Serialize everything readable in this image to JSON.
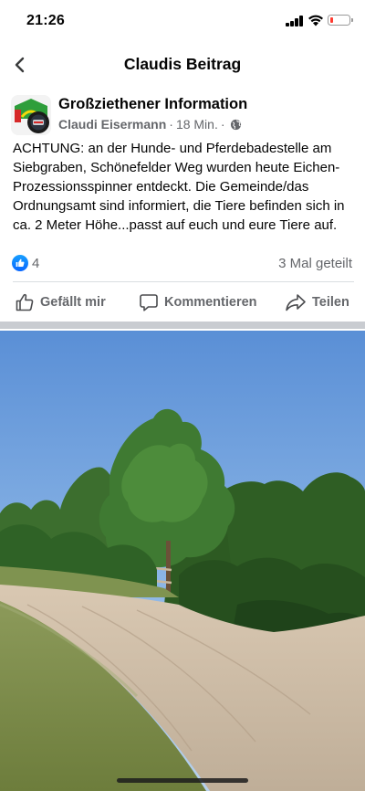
{
  "status_bar": {
    "time": "21:26",
    "battery_level": 0.15,
    "battery_color": "#ff3b30"
  },
  "nav": {
    "title": "Claudis Beitrag",
    "back_icon": "chevron-left-icon"
  },
  "post": {
    "group_name": "Großziethener Information",
    "author": "Claudi Eisermann",
    "time_ago": "18 Min.",
    "separator": "·",
    "privacy_icon": "globe-icon",
    "text": "ACHTUNG: an der Hunde- und Pferdebadestelle am Siebgraben, Schönefelder Weg wurden heute Eichen-Prozessionsspinner entdeckt. Die Gemeinde/das Ordnungsamt sind informiert, die Tiere befinden sich in ca. 2 Meter Höhe...passt auf euch und eure Tiere auf.",
    "reaction_count": "4",
    "share_count": "3 Mal geteilt",
    "actions": {
      "like": "Gefällt mir",
      "comment": "Kommentieren",
      "share": "Teilen"
    }
  },
  "colors": {
    "accent": "#0866ff",
    "secondary_text": "#65676b",
    "divider": "#dadde1"
  }
}
